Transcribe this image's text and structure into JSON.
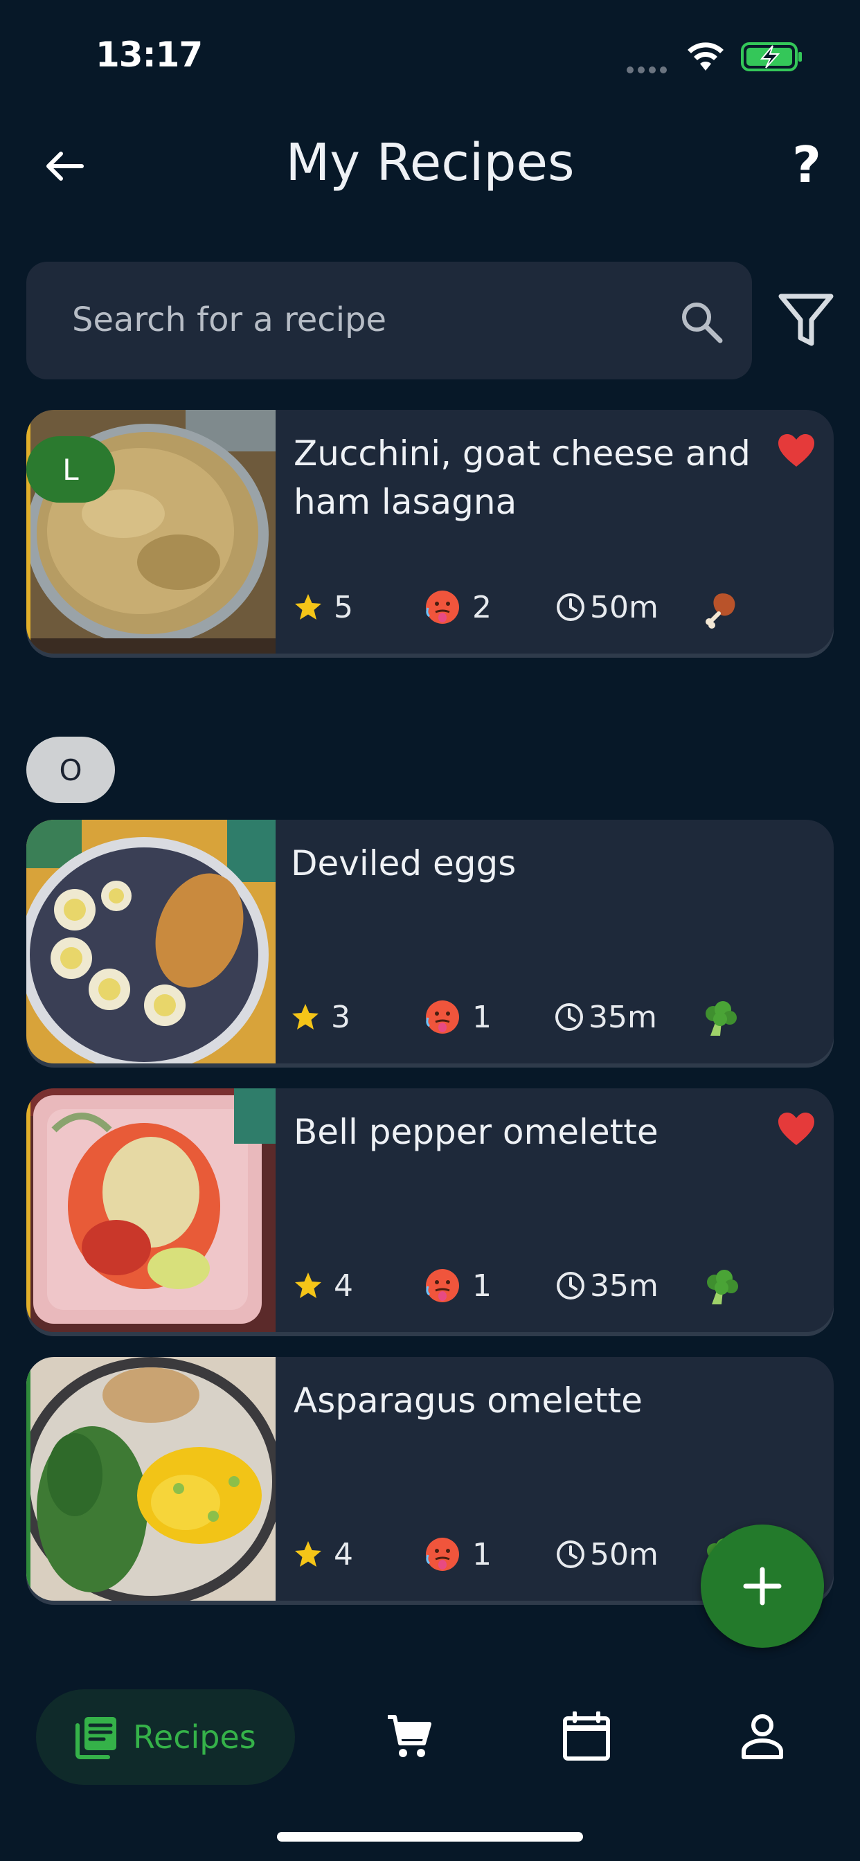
{
  "status_bar": {
    "time": "13:17"
  },
  "header": {
    "title": "My Recipes",
    "back_icon": "arrow-left-icon",
    "help_label": "?"
  },
  "search": {
    "placeholder": "Search for a recipe"
  },
  "sections": [
    {
      "letter": "L"
    },
    {
      "letter": "O"
    }
  ],
  "recipes": [
    {
      "name": "Zucchini, goat cheese and ham lasagna",
      "rating": "5",
      "difficulty": "2",
      "time": "50m",
      "type": "meat",
      "favorite": true
    },
    {
      "name": "Deviled eggs",
      "rating": "3",
      "difficulty": "1",
      "time": "35m",
      "type": "vegetarian",
      "favorite": false
    },
    {
      "name": "Bell pepper omelette",
      "rating": "4",
      "difficulty": "1",
      "time": "35m",
      "type": "vegetarian",
      "favorite": true
    },
    {
      "name": "Asparagus omelette",
      "rating": "4",
      "difficulty": "1",
      "time": "50m",
      "type": "vegetarian",
      "favorite": false
    }
  ],
  "fab": {
    "label": "+"
  },
  "bottom_nav": [
    {
      "label": "Recipes",
      "icon": "recipes-icon",
      "active": true
    },
    {
      "label": "",
      "icon": "cart-icon",
      "active": false
    },
    {
      "label": "",
      "icon": "calendar-icon",
      "active": false
    },
    {
      "label": "",
      "icon": "profile-icon",
      "active": false
    }
  ],
  "colors": {
    "background": "#071828",
    "card": "#1e293a",
    "accent_green": "#237a2b",
    "favorite_red": "#e53a3a",
    "star_yellow": "#f5c518"
  }
}
